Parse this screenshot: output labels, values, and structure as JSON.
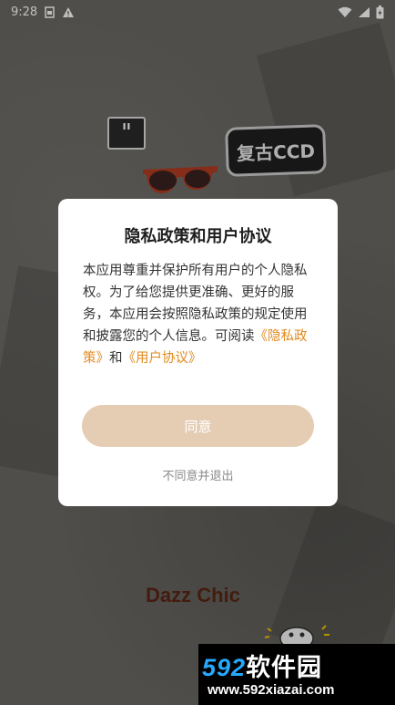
{
  "status_bar": {
    "time": "9:28",
    "icons": [
      "sim-card-icon",
      "warning-icon",
      "wifi-icon",
      "signal-icon",
      "battery-charging-icon"
    ]
  },
  "background": {
    "stickers": {
      "quote": "\"",
      "vintage": "复古CCD"
    },
    "brand_name": "Dazz Chic"
  },
  "dialog": {
    "title": "隐私政策和用户协议",
    "body_text": "本应用尊重并保护所有用户的个人隐私权。为了给您提供更准确、更好的服务，本应用会按照隐私政策的规定使用和披露您的个人信息。可阅读",
    "privacy_link": "《隐私政策》",
    "and_text": "和",
    "agreement_link": "《用户协议》",
    "agree_button": "同意",
    "disagree_link": "不同意并退出"
  },
  "watermark": {
    "logo_num": "592",
    "logo_text": "软件园",
    "url": "www.592xiazai.com"
  },
  "colors": {
    "link": "#e08a1e",
    "agree_button_bg": "#e5cdb3",
    "brand": "#5a2614",
    "watermark_accent": "#27a8ff"
  }
}
